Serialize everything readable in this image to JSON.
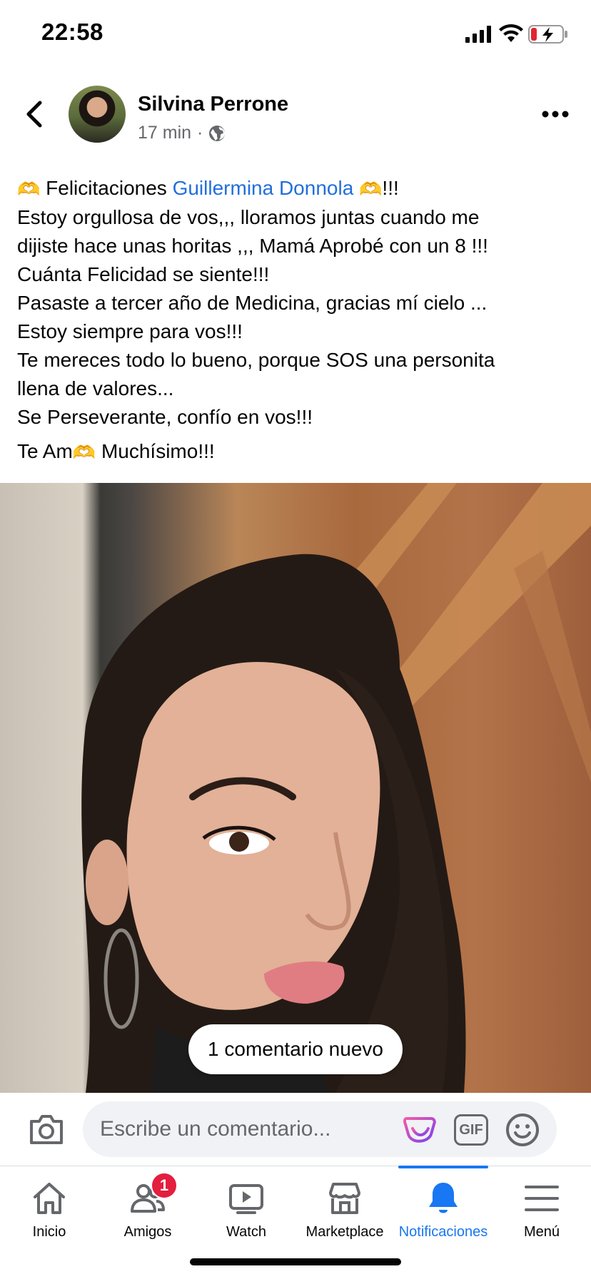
{
  "status_bar": {
    "time": "22:58"
  },
  "post": {
    "author": "Silvina Perrone",
    "time": "17 min",
    "separator": "·",
    "heart_emoji": "🫶",
    "lines": {
      "l1_before": "Felicitaciones",
      "l1_mention": "Guillermina Donnola",
      "l1_after": "!!!",
      "l2": "Estoy orgullosa de vos,,, lloramos juntas cuando me",
      "l3": "dijiste hace unas horitas ,,, Mamá Aprobé con un 8 !!!",
      "l4": "Cuánta Felicidad se siente!!!",
      "l5": "Pasaste a tercer año de Medicina, gracias mí cielo ...",
      "l6": "Estoy siempre para vos!!!",
      "l7": "Te mereces todo lo bueno, porque SOS una personita",
      "l8": "llena de valores...",
      "l9": "Se Perseverante, confío en vos!!!",
      "l10_before": "Te Am",
      "l10_after": " Muchísimo!!!"
    }
  },
  "new_comment_pill": "1 comentario nuevo",
  "comment_bar": {
    "placeholder": "Escribe un comentario...",
    "gif_label": "GIF"
  },
  "nav": {
    "tabs": [
      {
        "label": "Inicio"
      },
      {
        "label": "Amigos",
        "badge": "1"
      },
      {
        "label": "Watch"
      },
      {
        "label": "Marketplace"
      },
      {
        "label": "Notificaciones",
        "active": true
      },
      {
        "label": "Menú"
      }
    ]
  },
  "colors": {
    "link": "#216fdb",
    "accent": "#1877f2",
    "badge": "#e41e3f",
    "secondary_text": "#65676b"
  }
}
